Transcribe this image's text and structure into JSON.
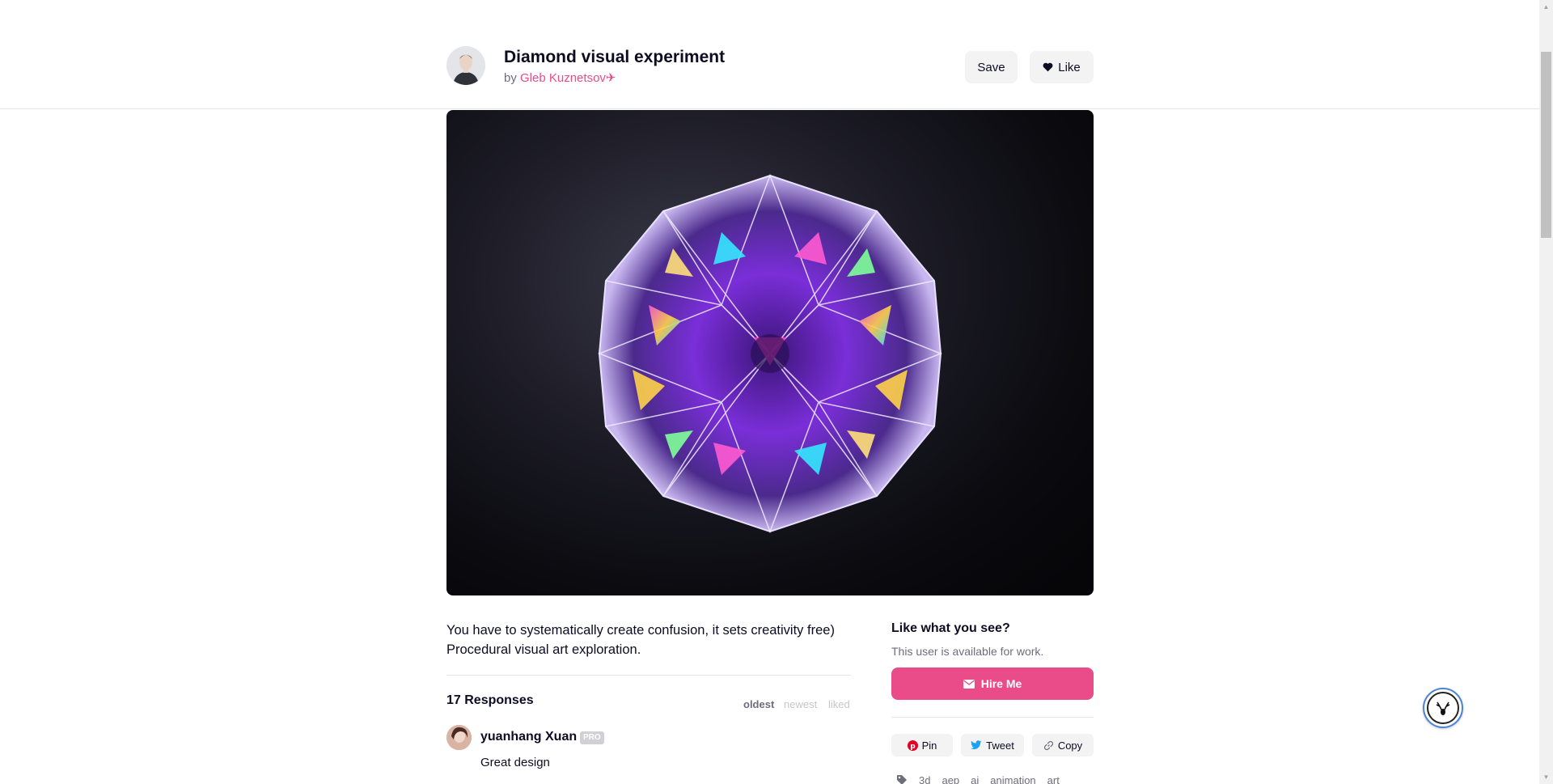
{
  "header": {
    "title": "Diamond visual experiment",
    "by_prefix": "by",
    "author": "Gleb Kuznetsov✈",
    "save_label": "Save",
    "like_label": "Like"
  },
  "shot": {
    "alt": "Diamond visual experiment"
  },
  "description": {
    "line1": "You have to systematically create confusion, it sets creativity free)",
    "line2": "Procedural visual art exploration."
  },
  "responses": {
    "title": "17 Responses",
    "sort_options": [
      "oldest",
      "newest",
      "liked"
    ],
    "comments": [
      {
        "author": "yuanhang Xuan",
        "badge": "PRO",
        "text": "Great design"
      }
    ]
  },
  "sidebar": {
    "title": "Like what you see?",
    "subtitle": "This user is available for work.",
    "hire_label": "Hire Me",
    "share": {
      "pin": "Pin",
      "tweet": "Tweet",
      "copy": "Copy"
    },
    "tags": [
      "3d",
      "aep",
      "ai",
      "animation",
      "art"
    ]
  },
  "colors": {
    "brand_pink": "#ea4c89",
    "text_dark": "#0d0c22",
    "text_muted": "#6e6d7a"
  }
}
